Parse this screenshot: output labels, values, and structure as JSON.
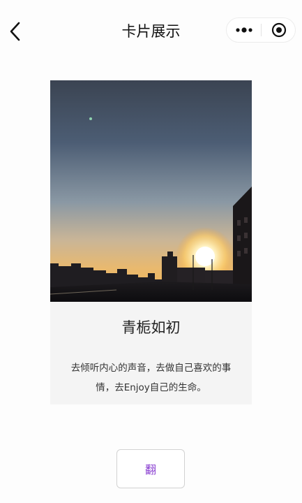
{
  "navbar": {
    "title": "卡片展示"
  },
  "card": {
    "title": "青栀如初",
    "description": "去倾听内心的声音，去做自己喜欢的事情，去Enjoy自己的生命。"
  },
  "flip_button": {
    "label": "翻"
  },
  "colors": {
    "button_text": "#8a3fd1",
    "card_background": "#f4f4f4"
  },
  "icons": {
    "back": "chevron-left-icon",
    "more": "more-dots-icon",
    "close": "target-circle-icon"
  }
}
